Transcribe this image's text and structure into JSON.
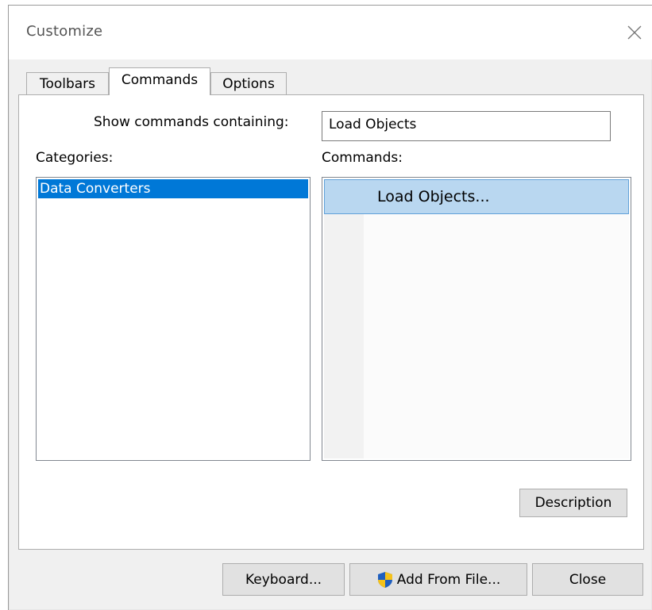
{
  "window": {
    "title": "Customize"
  },
  "tabs": [
    {
      "label": "Toolbars",
      "active": false
    },
    {
      "label": "Commands",
      "active": true
    },
    {
      "label": "Options",
      "active": false
    }
  ],
  "commands_tab": {
    "search_label": "Show commands containing:",
    "search_value": "Load Objects",
    "categories_label": "Categories:",
    "categories": [
      "Data Converters"
    ],
    "commands_label": "Commands:",
    "commands": [
      "Load Objects..."
    ],
    "description_button": "Description"
  },
  "footer": {
    "keyboard_button": "Keyboard...",
    "add_from_file_button": "Add From File...",
    "close_button": "Close"
  },
  "colors": {
    "selection": "#0078d7",
    "command_highlight": "#b9d7f0",
    "shield_blue": "#1f5fbf",
    "shield_yellow": "#f5c21a"
  }
}
